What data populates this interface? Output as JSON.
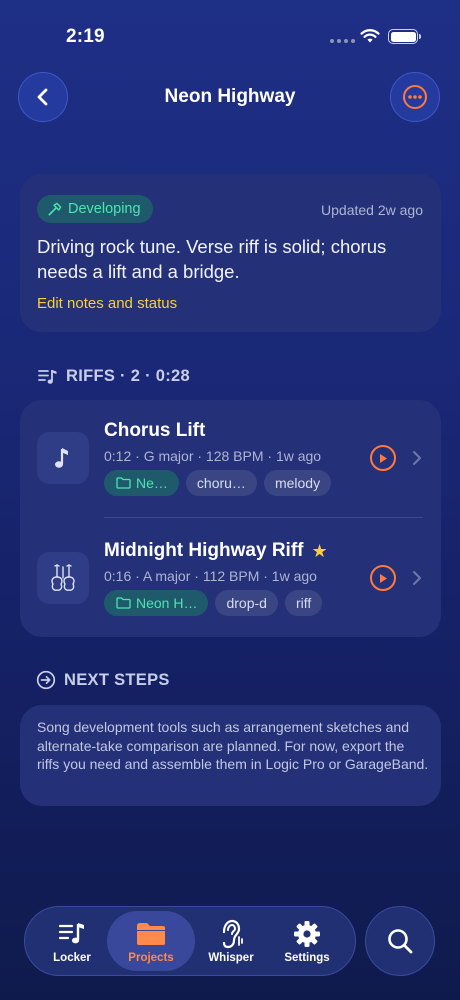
{
  "status_bar": {
    "time": "2:19"
  },
  "header": {
    "title": "Neon Highway"
  },
  "status_card": {
    "badge": "Developing",
    "updated": "Updated 2w ago",
    "notes": "Driving rock tune. Verse riff is solid; chorus needs a lift and a bridge.",
    "edit_link": "Edit notes and status"
  },
  "riffs": {
    "section_title": "RIFFS · 2 · 0:28",
    "items": [
      {
        "title": "Chorus Lift",
        "meta": "0:12 · G major · 128 BPM · 1w ago",
        "starred": false,
        "chips": [
          "Ne…",
          "choru…",
          "melody"
        ],
        "icon": "music-note-icon"
      },
      {
        "title": "Midnight Highway Riff",
        "meta": "0:16 · A major · 112 BPM · 1w ago",
        "starred": true,
        "chips": [
          "Neon H…",
          "drop-d",
          "riff"
        ],
        "icon": "guitars-icon"
      }
    ]
  },
  "next_steps": {
    "section_title": "NEXT STEPS",
    "text": "Song development tools such as arrangement sketches and alternate-take comparison are planned. For now, export the riffs you need and assemble them in Logic Pro or GarageBand."
  },
  "tabbar": {
    "active": "Projects",
    "tabs": [
      {
        "label": "Locker",
        "icon": "music-list-icon"
      },
      {
        "label": "Projects",
        "icon": "folder-icon"
      },
      {
        "label": "Whisper",
        "icon": "ear-icon"
      },
      {
        "label": "Settings",
        "icon": "gear-icon"
      }
    ]
  },
  "colors": {
    "accent_orange": "#ff7a3c",
    "accent_yellow": "#f7cf3a",
    "accent_green": "#4fe3b0",
    "card_bg": "#243178"
  }
}
